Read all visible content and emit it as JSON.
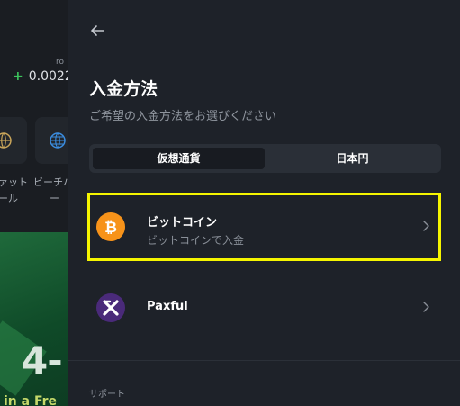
{
  "background_page": {
    "small_label": "ro",
    "balance_sign": "+",
    "balance": "0.0022",
    "tile_label_1a": "ァット",
    "tile_label_1b": "ール",
    "tile_label_2a": "ビーチバ",
    "tile_label_2b": "ー",
    "banner_big": "4-",
    "banner_small": "in a Fre"
  },
  "panel": {
    "title": "入金方法",
    "subtitle": "ご希望の入金方法をお選びください",
    "tabs": [
      {
        "label": "仮想通貨",
        "active": true
      },
      {
        "label": "日本円",
        "active": false
      }
    ],
    "methods": [
      {
        "name": "ビットコイン",
        "description": "ビットコインで入金",
        "icon": "bitcoin-icon",
        "color": "#f7931a"
      },
      {
        "name": "Paxful",
        "description": "",
        "icon": "paxful-icon",
        "color": "#4a2a7a"
      }
    ],
    "support_label": "サポート"
  },
  "colors": {
    "panel_bg": "#1e2229",
    "highlight": "#f5f500",
    "accent_green": "#3cc35c"
  }
}
